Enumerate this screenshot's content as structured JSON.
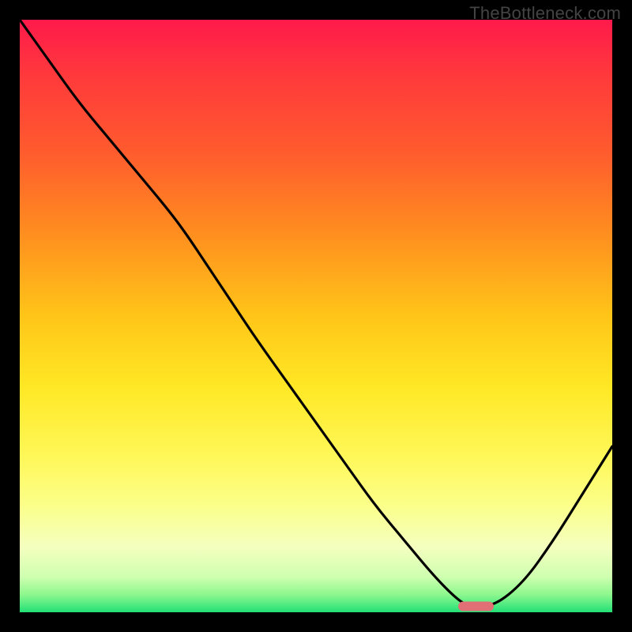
{
  "watermark": "TheBottleneck.com",
  "colors": {
    "frame": "#000000",
    "watermark_text": "#444444",
    "curve_stroke": "#000000",
    "marker_fill": "#e07076",
    "gradient_stops": [
      {
        "offset": 0.0,
        "color": "#ff1a4b"
      },
      {
        "offset": 0.1,
        "color": "#ff3b3b"
      },
      {
        "offset": 0.22,
        "color": "#ff5a2e"
      },
      {
        "offset": 0.35,
        "color": "#ff8a20"
      },
      {
        "offset": 0.5,
        "color": "#ffc518"
      },
      {
        "offset": 0.62,
        "color": "#ffe825"
      },
      {
        "offset": 0.74,
        "color": "#fff85a"
      },
      {
        "offset": 0.82,
        "color": "#fbff8a"
      },
      {
        "offset": 0.89,
        "color": "#f4ffbf"
      },
      {
        "offset": 0.94,
        "color": "#cfffb0"
      },
      {
        "offset": 0.97,
        "color": "#8ef78e"
      },
      {
        "offset": 1.0,
        "color": "#22e077"
      }
    ]
  },
  "chart_data": {
    "type": "line",
    "title": "",
    "xlabel": "",
    "ylabel": "",
    "xlim": [
      0,
      100
    ],
    "ylim": [
      0,
      100
    ],
    "grid": false,
    "legend": false,
    "x": [
      0,
      5,
      10,
      15,
      20,
      25,
      28,
      32,
      36,
      40,
      45,
      50,
      55,
      60,
      65,
      70,
      74,
      76,
      80,
      85,
      90,
      95,
      100
    ],
    "values": [
      100,
      93,
      86,
      80,
      74,
      68,
      64,
      58,
      52,
      46,
      39,
      32,
      25,
      18,
      12,
      6,
      2,
      1,
      1,
      5,
      12,
      20,
      28
    ],
    "marker": {
      "x_start": 74,
      "x_end": 80,
      "y": 1
    }
  }
}
